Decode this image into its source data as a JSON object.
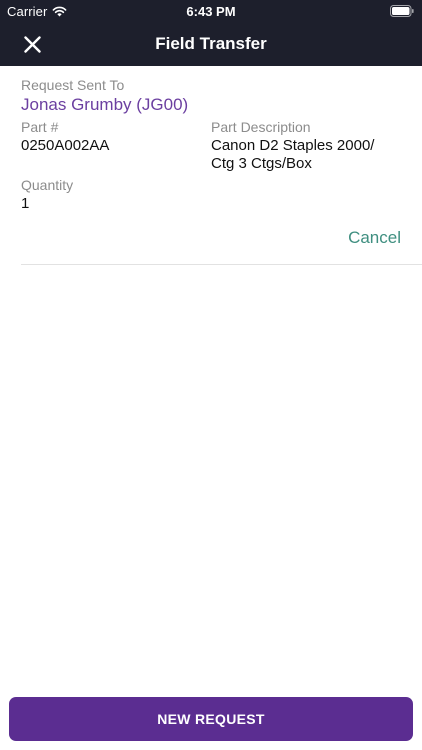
{
  "status_bar": {
    "carrier": "Carrier",
    "time": "6:43 PM",
    "icons": [
      "wifi-icon",
      "battery-icon"
    ]
  },
  "nav": {
    "title": "Field Transfer",
    "close_icon": "close-icon"
  },
  "request": {
    "sent_to_label": "Request Sent To",
    "sent_to_value": "Jonas Grumby (JG00)",
    "part_number_label": "Part #",
    "part_number_value": "0250A002AA",
    "part_description_label": "Part Description",
    "part_description_value": "Canon D2 Staples 2000/\nCtg 3 Ctgs/Box",
    "quantity_label": "Quantity",
    "quantity_value": "1",
    "cancel_label": "Cancel"
  },
  "footer": {
    "new_request_label": "NEW REQUEST"
  },
  "colors": {
    "header_bg": "#1d1f2c",
    "accent_purple": "#5b2d91",
    "name_purple": "#6b3fa0",
    "cancel_teal": "#3f8f80",
    "label_gray": "#8c8c8c"
  }
}
